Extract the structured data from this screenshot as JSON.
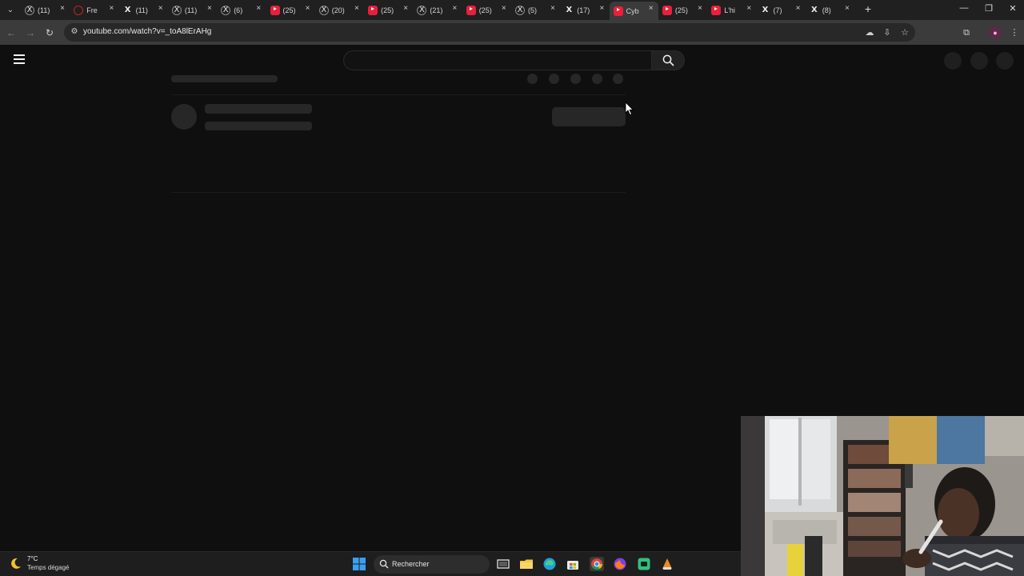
{
  "browser": {
    "tabs": [
      {
        "favicon": "x-circle-icon",
        "title": "(11)",
        "active": false
      },
      {
        "favicon": "loading-ring-icon",
        "title": "Fre",
        "active": false
      },
      {
        "favicon": "x-logo-icon",
        "title": "(11)",
        "active": false
      },
      {
        "favicon": "x-circle-icon",
        "title": "(11)",
        "active": false
      },
      {
        "favicon": "x-circle-icon",
        "title": "(6)",
        "active": false
      },
      {
        "favicon": "youtube-icon",
        "title": "(25)",
        "active": false
      },
      {
        "favicon": "x-circle-icon",
        "title": "(20)",
        "active": false
      },
      {
        "favicon": "youtube-icon",
        "title": "(25)",
        "active": false
      },
      {
        "favicon": "x-circle-icon",
        "title": "(21)",
        "active": false
      },
      {
        "favicon": "youtube-icon",
        "title": "(25)",
        "active": false
      },
      {
        "favicon": "x-circle-icon",
        "title": "(5)",
        "active": false
      },
      {
        "favicon": "x-logo-icon",
        "title": "(17)",
        "active": false
      },
      {
        "favicon": "youtube-icon",
        "title": "Cyb",
        "active": true
      },
      {
        "favicon": "youtube-icon",
        "title": "(25)",
        "active": false
      },
      {
        "favicon": "youtube-icon",
        "title": "L'hi",
        "active": false
      },
      {
        "favicon": "x-logo-icon",
        "title": "(7)",
        "active": false
      },
      {
        "favicon": "x-logo-icon",
        "title": "(8)",
        "active": false
      }
    ],
    "close_glyph": "×",
    "new_tab_glyph": "+",
    "url": "youtube.com/watch?v=_toA8lErAHg",
    "window_controls": {
      "minimize": "—",
      "restore": "❐",
      "close": "✕"
    }
  },
  "taskbar": {
    "weather_temp": "7°C",
    "weather_desc": "Temps dégagé",
    "search_placeholder": "Rechercher"
  },
  "colors": {
    "page_bg": "#0f0f0f",
    "skeleton": "#272727",
    "tab_strip": "#202020",
    "active_tab": "#3b3b3b",
    "youtube_red": "#e8203a"
  }
}
